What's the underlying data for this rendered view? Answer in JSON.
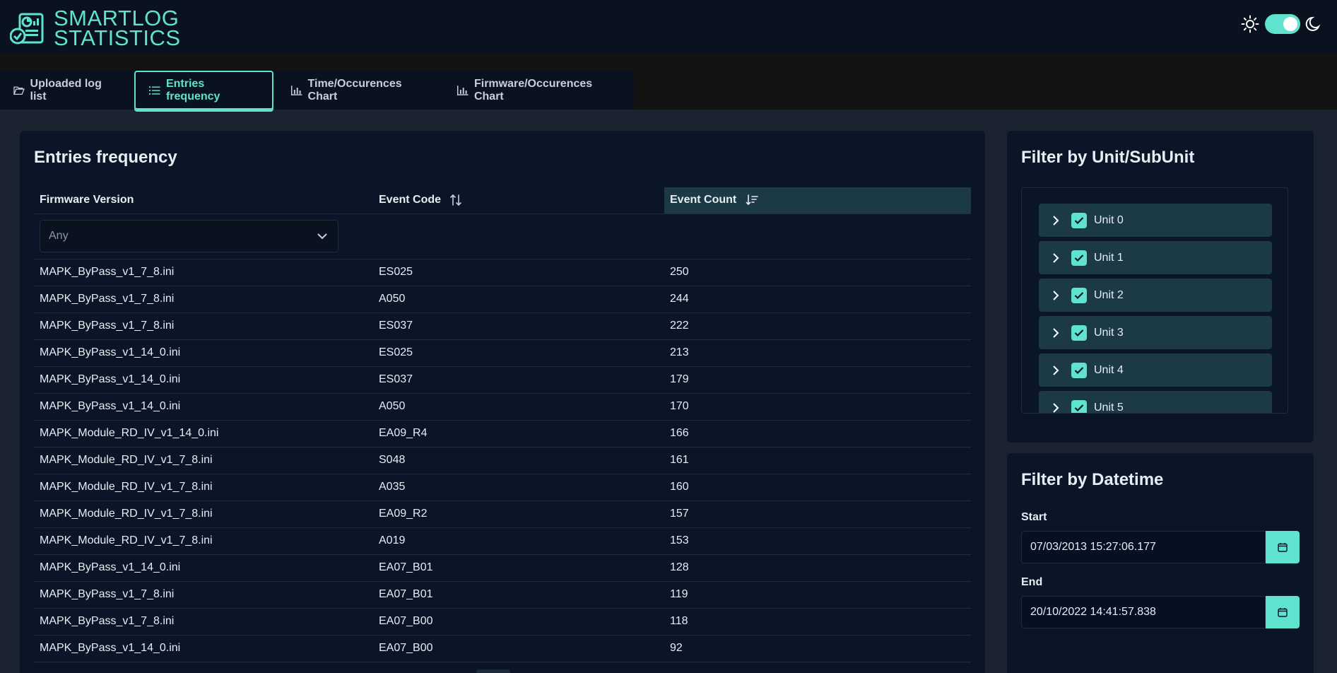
{
  "app": {
    "logo_line1": "SMARTLOG",
    "logo_line2": "STATISTICS",
    "accent": "#5fe3cf",
    "background": "#0a1220",
    "theme_toggle": {
      "sun_icon": "sun-icon",
      "moon_icon": "moon-icon",
      "state": "dark"
    }
  },
  "tabs": [
    {
      "label": "Uploaded log list",
      "icon": "folder-open-icon"
    },
    {
      "label": "Entries frequency",
      "icon": "list-icon",
      "active": true
    },
    {
      "label": "Time/Occurences Chart",
      "icon": "bar-chart-icon"
    },
    {
      "label": "Firmware/Occurences Chart",
      "icon": "bar-chart-icon"
    }
  ],
  "entries": {
    "title": "Entries frequency",
    "columns": {
      "firmware": "Firmware Version",
      "event_code": "Event Code",
      "event_count": "Event Count"
    },
    "filter": {
      "firmware_placeholder": "Any"
    },
    "rows": [
      {
        "firmware": "MAPK_ByPass_v1_7_8.ini",
        "code": "ES025",
        "count": "250"
      },
      {
        "firmware": "MAPK_ByPass_v1_7_8.ini",
        "code": "A050",
        "count": "244"
      },
      {
        "firmware": "MAPK_ByPass_v1_7_8.ini",
        "code": "ES037",
        "count": "222"
      },
      {
        "firmware": "MAPK_ByPass_v1_14_0.ini",
        "code": "ES025",
        "count": "213"
      },
      {
        "firmware": "MAPK_ByPass_v1_14_0.ini",
        "code": "ES037",
        "count": "179"
      },
      {
        "firmware": "MAPK_ByPass_v1_14_0.ini",
        "code": "A050",
        "count": "170"
      },
      {
        "firmware": "MAPK_Module_RD_IV_v1_14_0.ini",
        "code": "EA09_R4",
        "count": "166"
      },
      {
        "firmware": "MAPK_Module_RD_IV_v1_7_8.ini",
        "code": "S048",
        "count": "161"
      },
      {
        "firmware": "MAPK_Module_RD_IV_v1_7_8.ini",
        "code": "A035",
        "count": "160"
      },
      {
        "firmware": "MAPK_Module_RD_IV_v1_7_8.ini",
        "code": "EA09_R2",
        "count": "157"
      },
      {
        "firmware": "MAPK_Module_RD_IV_v1_7_8.ini",
        "code": "A019",
        "count": "153"
      },
      {
        "firmware": "MAPK_ByPass_v1_14_0.ini",
        "code": "EA07_B01",
        "count": "128"
      },
      {
        "firmware": "MAPK_ByPass_v1_7_8.ini",
        "code": "EA07_B01",
        "count": "119"
      },
      {
        "firmware": "MAPK_ByPass_v1_7_8.ini",
        "code": "EA07_B00",
        "count": "118"
      },
      {
        "firmware": "MAPK_ByPass_v1_14_0.ini",
        "code": "EA07_B00",
        "count": "92"
      }
    ]
  },
  "unit_filter": {
    "title": "Filter by Unit/SubUnit",
    "units": [
      {
        "label": "Unit 0",
        "checked": true
      },
      {
        "label": "Unit 1",
        "checked": true
      },
      {
        "label": "Unit 2",
        "checked": true
      },
      {
        "label": "Unit 3",
        "checked": true
      },
      {
        "label": "Unit 4",
        "checked": true
      },
      {
        "label": "Unit 5",
        "checked": true
      }
    ]
  },
  "date_filter": {
    "title": "Filter by Datetime",
    "start_label": "Start",
    "start_value": "07/03/2013 15:27:06.177",
    "end_label": "End",
    "end_value": "20/10/2022 14:41:57.838"
  }
}
